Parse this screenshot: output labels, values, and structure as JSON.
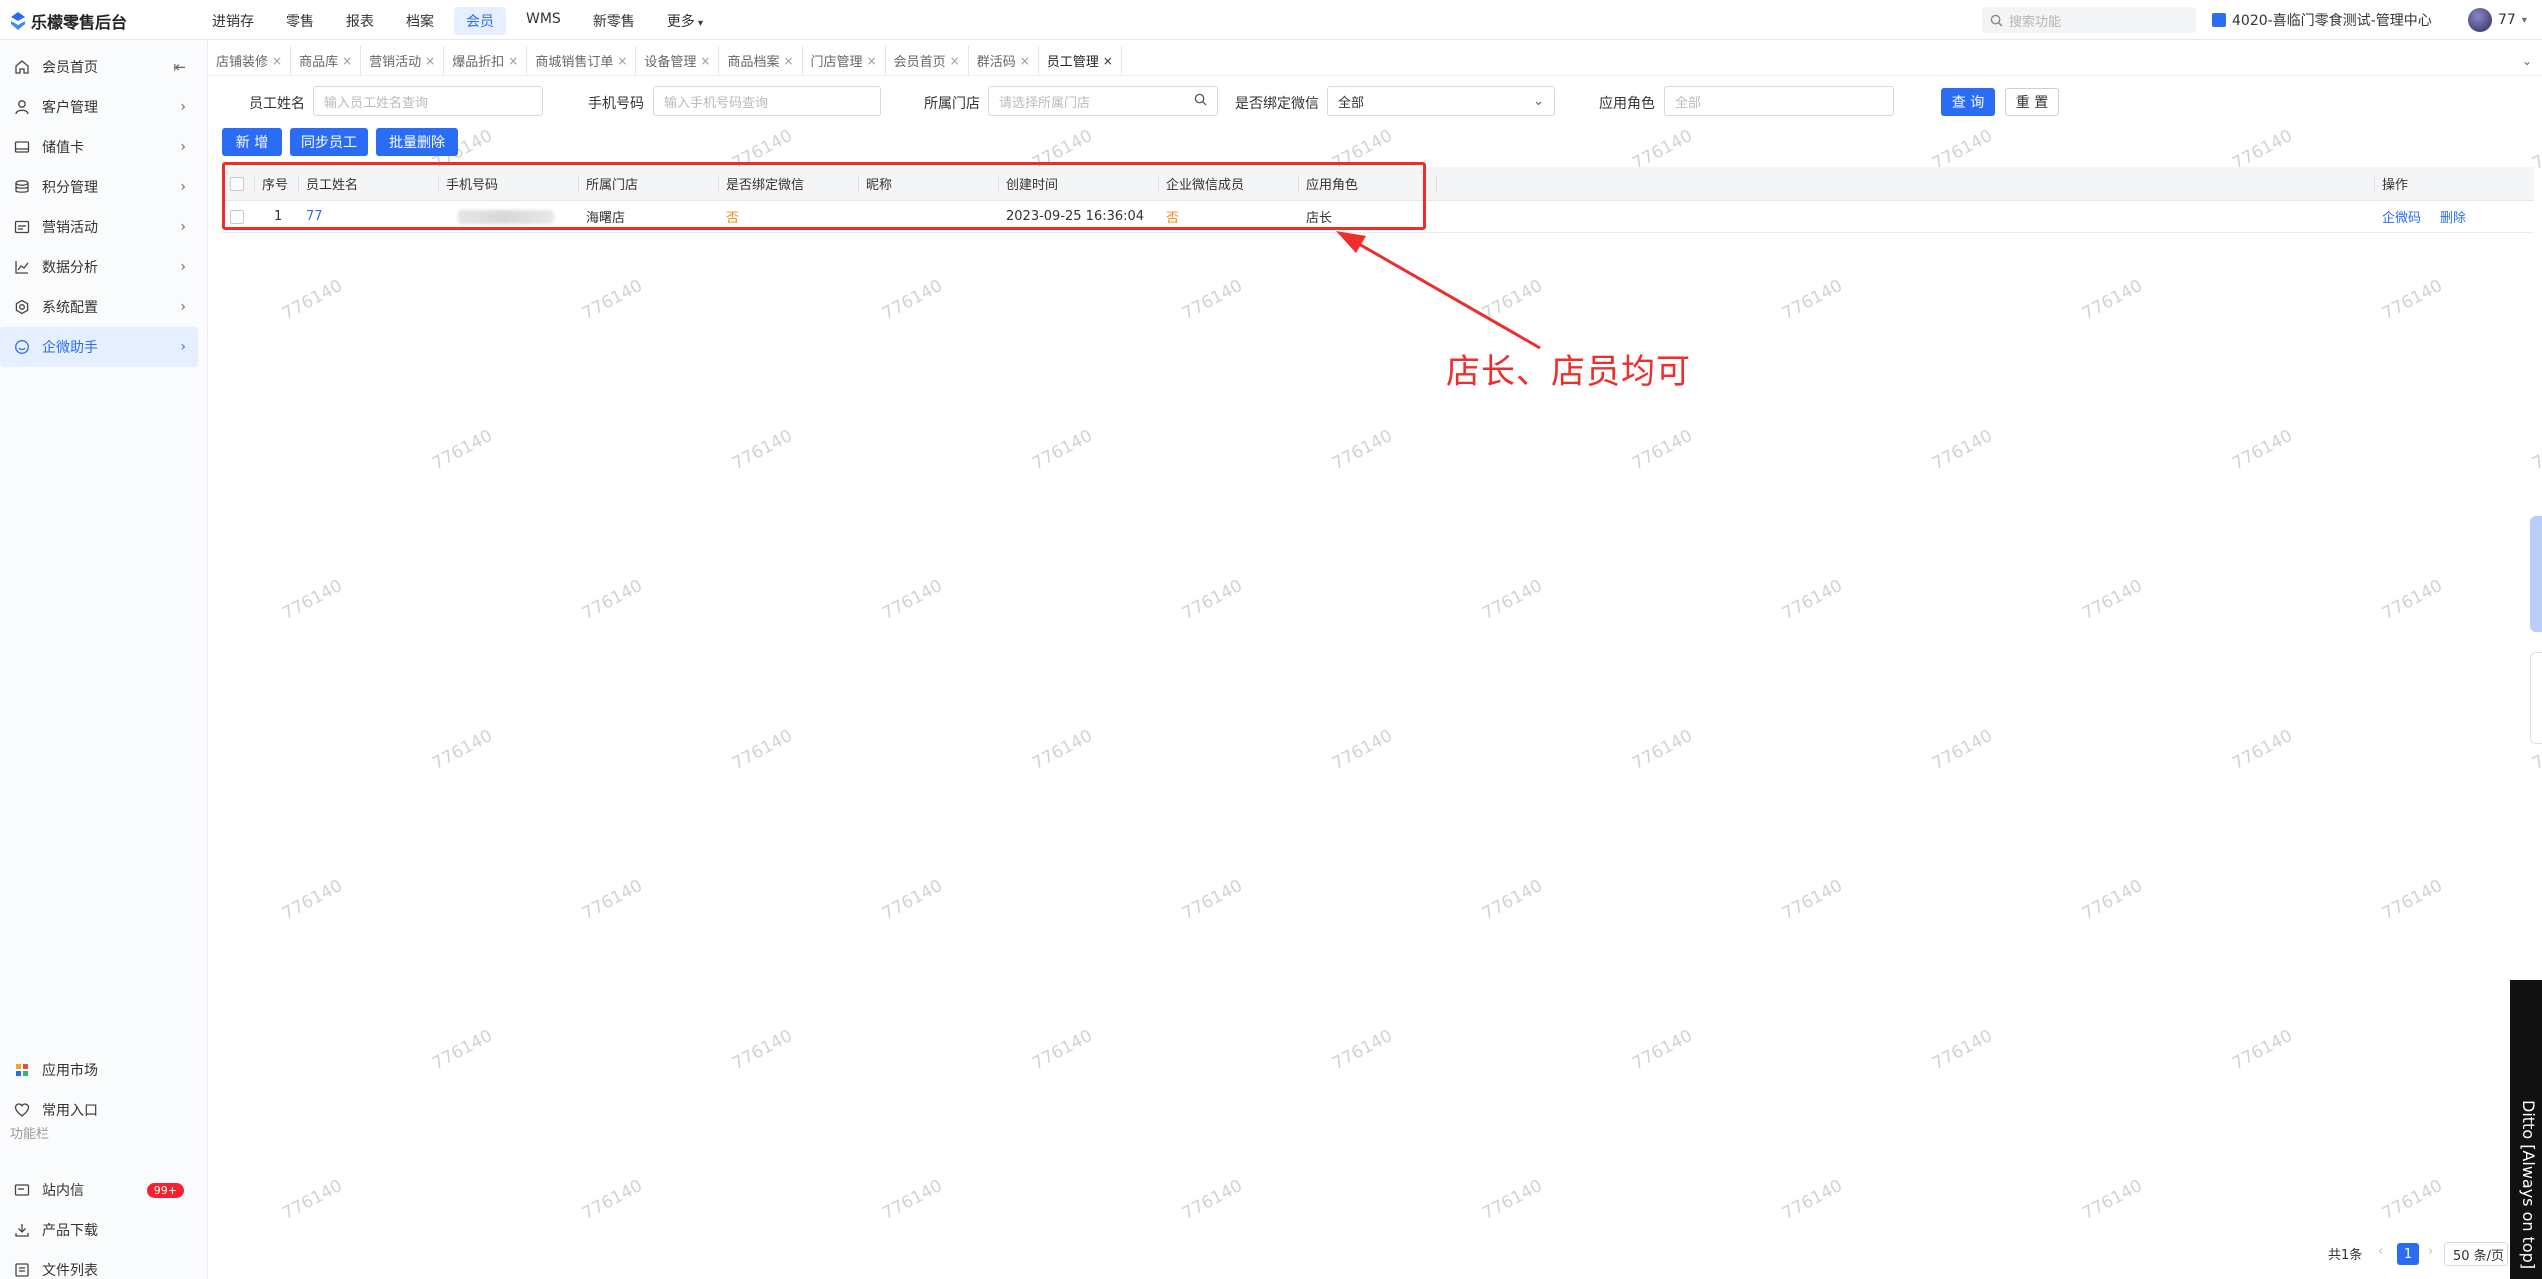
{
  "app": {
    "title": "乐檬零售后台"
  },
  "topnav": {
    "items": [
      "进销存",
      "零售",
      "报表",
      "档案",
      "会员",
      "WMS",
      "新零售",
      "更多"
    ],
    "active": "会员"
  },
  "search": {
    "placeholder": "搜索功能"
  },
  "store": {
    "name": "4020-喜临门零食测试-管理中心"
  },
  "user": {
    "name": "77"
  },
  "sidebar": {
    "items": [
      {
        "label": "会员首页",
        "icon": "home-icon"
      },
      {
        "label": "客户管理",
        "icon": "user-icon"
      },
      {
        "label": "储值卡",
        "icon": "card-icon"
      },
      {
        "label": "积分管理",
        "icon": "database-icon"
      },
      {
        "label": "营销活动",
        "icon": "campaign-icon"
      },
      {
        "label": "数据分析",
        "icon": "chart-icon"
      },
      {
        "label": "系统配置",
        "icon": "settings-icon"
      },
      {
        "label": "企微助手",
        "icon": "chat-icon"
      }
    ],
    "bottom": [
      {
        "label": "应用市场",
        "icon": "apps-icon"
      },
      {
        "label": "常用入口",
        "icon": "heart-icon"
      }
    ],
    "section_title": "功能栏",
    "tools": [
      {
        "label": "站内信",
        "icon": "mail-icon",
        "badge": "99+"
      },
      {
        "label": "产品下载",
        "icon": "download-icon"
      },
      {
        "label": "文件列表",
        "icon": "file-list-icon"
      }
    ]
  },
  "tabs": [
    "店铺装修",
    "商品库",
    "营销活动",
    "爆品折扣",
    "商城销售订单",
    "设备管理",
    "商品档案",
    "门店管理",
    "会员首页",
    "群活码",
    "员工管理"
  ],
  "filters": {
    "name_label": "员工姓名",
    "name_placeholder": "输入员工姓名查询",
    "phone_label": "手机号码",
    "phone_placeholder": "输入手机号码查询",
    "store_label": "所属门店",
    "store_placeholder": "请选择所属门店",
    "wechat_label": "是否绑定微信",
    "wechat_value": "全部",
    "role_label": "应用角色",
    "role_placeholder": "全部",
    "query_label": "查 询",
    "reset_label": "重 置"
  },
  "actions": {
    "add": "新 增",
    "sync": "同步员工",
    "batch_delete": "批量删除"
  },
  "table": {
    "headers": [
      "序号",
      "员工姓名",
      "手机号码",
      "所属门店",
      "是否绑定微信",
      "昵称",
      "创建时间",
      "企业微信成员",
      "应用角色",
      "操作"
    ],
    "rows": [
      {
        "index": "1",
        "name": "77",
        "phone": "",
        "store": "海曙店",
        "wechat_bound": "否",
        "nickname": "",
        "created": "2023-09-25 16:36:04",
        "wecom_member": "否",
        "role": "店长",
        "op_code": "企微码",
        "op_delete": "删除"
      }
    ]
  },
  "annotation": {
    "text": "店长、店员均可",
    "color": "#ee2d2d"
  },
  "pagination": {
    "total": "共1条",
    "current": "1",
    "page_size": "50 条/页"
  },
  "watermark": "776140",
  "overlay": {
    "ditto_text": "Ditto [Always on top]"
  },
  "colors": {
    "primary": "#2a6df4",
    "warning": "#f28b1a",
    "annotation": "#ee2d2d",
    "badge": "#f5222d"
  }
}
